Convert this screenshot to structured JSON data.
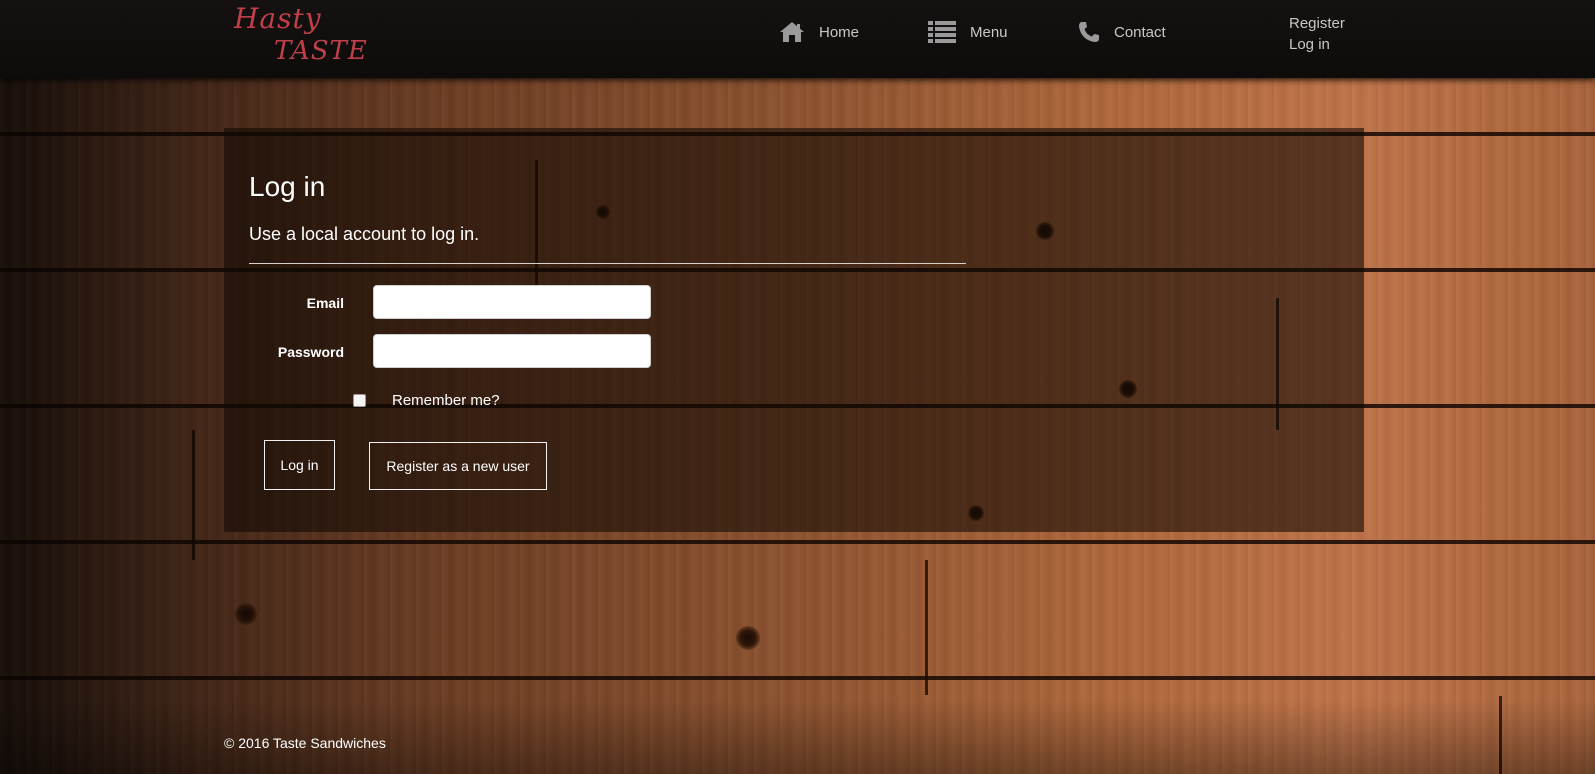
{
  "brand": {
    "line1": "Hasty",
    "line2": "TASTE"
  },
  "nav": {
    "home": {
      "label": "Home",
      "icon": "home-icon"
    },
    "menu": {
      "label": "Menu",
      "icon": "list-icon"
    },
    "contact": {
      "label": "Contact",
      "icon": "phone-icon"
    },
    "register": "Register",
    "login": "Log in"
  },
  "login": {
    "title": "Log in",
    "subtitle": "Use a local account to log in.",
    "email_label": "Email",
    "email_value": "",
    "password_label": "Password",
    "password_value": "",
    "remember_label": "Remember me?",
    "remember_checked": false,
    "login_button": "Log in",
    "register_button": "Register as a new user"
  },
  "footer": {
    "copyright": "© 2016 Taste Sandwiches"
  },
  "colors": {
    "brand": "#c0404a",
    "navbar": "#121010",
    "nav_text": "#c8c8c8",
    "panel_overlay": "rgba(15,8,4,0.58)",
    "text": "#ffffff"
  }
}
